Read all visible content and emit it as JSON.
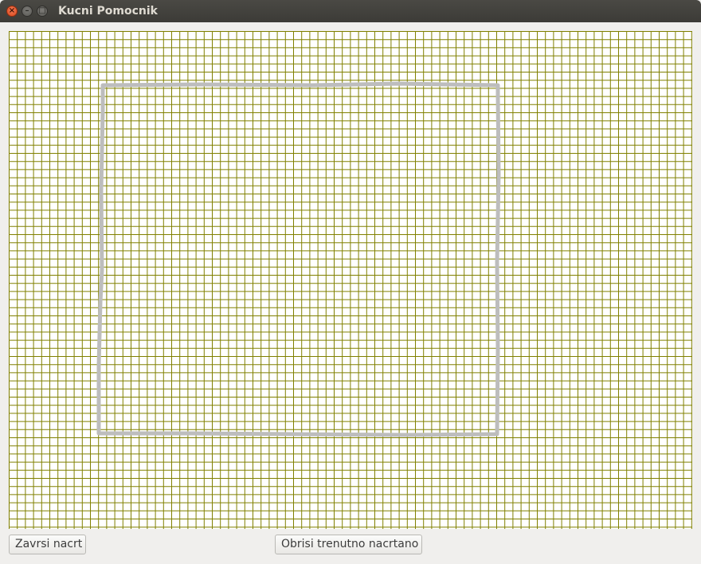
{
  "window": {
    "title": "Kucni Pomocnik",
    "controls": {
      "close_glyph": "×",
      "minimize_glyph": "–",
      "maximize_glyph": "□"
    }
  },
  "canvas": {
    "grid_color": "#808000",
    "background_color": "#ffffff",
    "stroke_color": "#bdbdbd"
  },
  "buttons": {
    "finish_label": "Zavrsi nacrt",
    "clear_label": "Obrisi trenutno nacrtano"
  }
}
